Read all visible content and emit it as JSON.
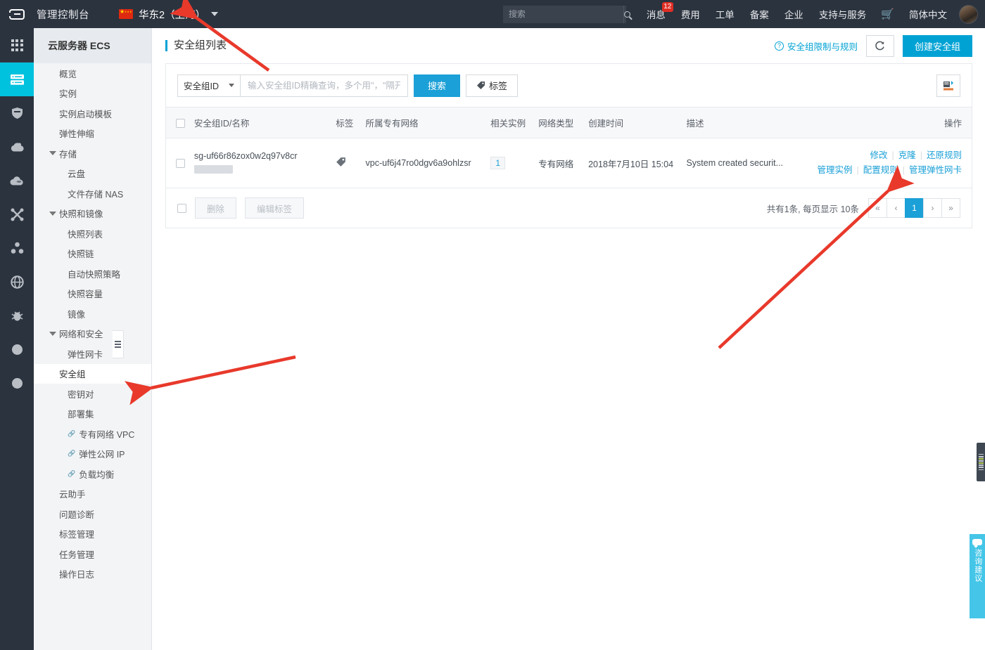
{
  "header": {
    "console_title": "管理控制台",
    "region": "华东2（上海）",
    "flag_icon": "cn-flag-icon",
    "search_placeholder": "搜索",
    "search_value": "",
    "nav": [
      {
        "label": "消息",
        "badge": "12"
      },
      {
        "label": "费用",
        "badge": ""
      },
      {
        "label": "工单",
        "badge": ""
      },
      {
        "label": "备案",
        "badge": ""
      },
      {
        "label": "企业",
        "badge": ""
      },
      {
        "label": "支持与服务",
        "badge": ""
      }
    ],
    "cart_icon": "shopping-cart-icon",
    "language": "简体中文",
    "avatar_icon": "user-avatar"
  },
  "rail": {
    "items": [
      {
        "name": "apps-grid",
        "icon": "grid-menu-icon",
        "active": false
      },
      {
        "name": "ecs",
        "icon": "server-icon",
        "active": true
      },
      {
        "name": "security",
        "icon": "shield-icon",
        "active": false
      },
      {
        "name": "cloud-storage",
        "icon": "cloud-icon",
        "active": false
      },
      {
        "name": "cloud-db",
        "icon": "cloud-database-icon",
        "active": false
      },
      {
        "name": "network",
        "icon": "network-cross-icon",
        "active": false
      },
      {
        "name": "cluster",
        "icon": "cluster-icon",
        "active": false
      },
      {
        "name": "cdn",
        "icon": "globe-icon",
        "active": false
      },
      {
        "name": "monitor",
        "icon": "bug-icon",
        "active": false
      },
      {
        "name": "more-1",
        "icon": "circle-icon",
        "active": false
      },
      {
        "name": "more-2",
        "icon": "circle-icon",
        "active": false
      }
    ]
  },
  "sidebar": {
    "product_title": "云服务器 ECS",
    "collapse_icon": "collapse-panel-icon",
    "items": [
      {
        "label": "概览",
        "level": 0,
        "group": false,
        "link": false,
        "active": false
      },
      {
        "label": "实例",
        "level": 0,
        "group": false,
        "link": false,
        "active": false
      },
      {
        "label": "实例启动模板",
        "level": 0,
        "group": false,
        "link": false,
        "active": false
      },
      {
        "label": "弹性伸缩",
        "level": 0,
        "group": false,
        "link": false,
        "active": false
      },
      {
        "label": "存储",
        "level": 0,
        "group": true,
        "link": false,
        "active": false
      },
      {
        "label": "云盘",
        "level": 1,
        "group": false,
        "link": false,
        "active": false
      },
      {
        "label": "文件存储 NAS",
        "level": 1,
        "group": false,
        "link": false,
        "active": false
      },
      {
        "label": "快照和镜像",
        "level": 0,
        "group": true,
        "link": false,
        "active": false
      },
      {
        "label": "快照列表",
        "level": 1,
        "group": false,
        "link": false,
        "active": false
      },
      {
        "label": "快照链",
        "level": 1,
        "group": false,
        "link": false,
        "active": false
      },
      {
        "label": "自动快照策略",
        "level": 1,
        "group": false,
        "link": false,
        "active": false
      },
      {
        "label": "快照容量",
        "level": 1,
        "group": false,
        "link": false,
        "active": false
      },
      {
        "label": "镜像",
        "level": 1,
        "group": false,
        "link": false,
        "active": false
      },
      {
        "label": "网络和安全",
        "level": 0,
        "group": true,
        "link": false,
        "active": false
      },
      {
        "label": "弹性网卡",
        "level": 1,
        "group": false,
        "link": false,
        "active": false
      },
      {
        "label": "安全组",
        "level": 1,
        "group": false,
        "link": false,
        "active": true
      },
      {
        "label": "密钥对",
        "level": 1,
        "group": false,
        "link": false,
        "active": false
      },
      {
        "label": "部署集",
        "level": 1,
        "group": false,
        "link": false,
        "active": false
      },
      {
        "label": "专有网络 VPC",
        "level": 1,
        "group": false,
        "link": true,
        "active": false
      },
      {
        "label": "弹性公网 IP",
        "level": 1,
        "group": false,
        "link": true,
        "active": false
      },
      {
        "label": "负载均衡",
        "level": 1,
        "group": false,
        "link": true,
        "active": false
      },
      {
        "label": "云助手",
        "level": 0,
        "group": false,
        "link": false,
        "active": false
      },
      {
        "label": "问题诊断",
        "level": 0,
        "group": false,
        "link": false,
        "active": false
      },
      {
        "label": "标签管理",
        "level": 0,
        "group": false,
        "link": false,
        "active": false
      },
      {
        "label": "任务管理",
        "level": 0,
        "group": false,
        "link": false,
        "active": false
      },
      {
        "label": "操作日志",
        "level": 0,
        "group": false,
        "link": false,
        "active": false
      }
    ]
  },
  "page": {
    "title": "安全组列表",
    "help_link": "安全组限制与规则",
    "help_icon": "question-circle-icon",
    "refresh_icon": "refresh-icon",
    "create_button": "创建安全组"
  },
  "filter": {
    "select_value": "安全组ID",
    "input_placeholder": "输入安全组ID精确查询，多个用\"，\"隔开",
    "input_value": "",
    "search_button": "搜索",
    "tag_button": "标签",
    "tag_icon": "tag-icon",
    "export_icon": "export-icon"
  },
  "table": {
    "columns": [
      "安全组ID/名称",
      "标签",
      "所属专有网络",
      "相关实例",
      "网络类型",
      "创建时间",
      "描述",
      "操作"
    ],
    "rows": [
      {
        "id": "sg-uf66r86zox0w2q97v8cr",
        "name_redacted": true,
        "tag_icon": "tag-icon",
        "vpc": "vpc-uf6j47ro0dgv6a9ohlzsr",
        "instances": "1",
        "network_type": "专有网络",
        "created": "2018年7月10日 15:04",
        "description": "System created securit...",
        "actions_row1": [
          "修改",
          "克隆",
          "还原规则"
        ],
        "actions_row2": [
          "管理实例",
          "配置规则",
          "管理弹性网卡"
        ]
      }
    ]
  },
  "footer": {
    "delete_button": "删除",
    "edit_tag_button": "编辑标签",
    "summary": "共有1条, 每页显示 10条",
    "pagination": {
      "first": "«",
      "prev": "‹",
      "pages": [
        "1"
      ],
      "current": "1",
      "next": "›",
      "last": "»"
    }
  },
  "widgets": {
    "slider_icon": "equalizer-slider-icon",
    "consult_icon": "chat-bubble-icon",
    "consult_text": "咨询建议"
  },
  "colors": {
    "accent": "#00a2d4",
    "link": "#1ba0d7",
    "topbar": "#2b333e",
    "rail_active": "#00c1de",
    "badge_red": "#e02e24",
    "annotation_arrow": "#e8392b",
    "consult_tab": "#45c6e8"
  }
}
